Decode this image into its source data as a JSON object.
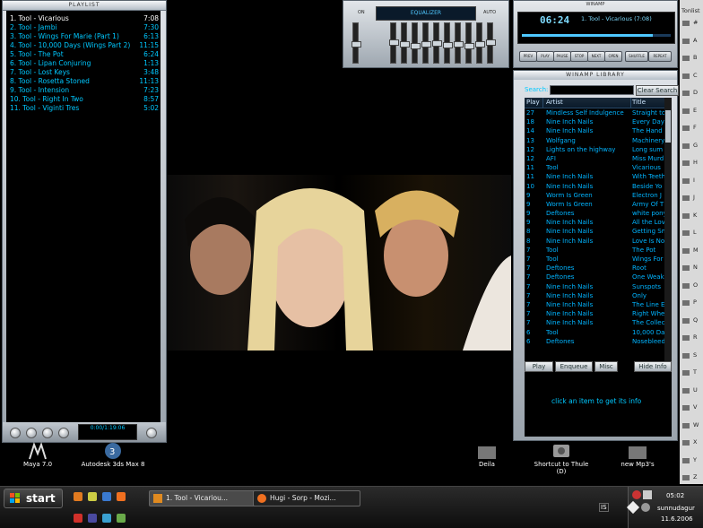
{
  "playlist": {
    "header": "PLAYLIST",
    "items": [
      {
        "title": "1. Tool - Vicarious",
        "duration": "7:08",
        "active": true
      },
      {
        "title": "2. Tool - Jambi",
        "duration": "7:30"
      },
      {
        "title": "3. Tool - Wings For Marie (Part 1)",
        "duration": "6:13"
      },
      {
        "title": "4. Tool - 10,000 Days (Wings Part 2)",
        "duration": "11:15"
      },
      {
        "title": "5. Tool - The Pot",
        "duration": "6:24"
      },
      {
        "title": "6. Tool - Lipan Conjuring",
        "duration": "1:13"
      },
      {
        "title": "7. Tool - Lost Keys",
        "duration": "3:48"
      },
      {
        "title": "8. Tool - Rosetta Stoned",
        "duration": "11:13"
      },
      {
        "title": "9. Tool - Intension",
        "duration": "7:23"
      },
      {
        "title": "10. Tool - Right In Two",
        "duration": "8:57"
      },
      {
        "title": "11. Tool - Viginti Tres",
        "duration": "5:02"
      }
    ],
    "time_display": "0:00/1:19:06"
  },
  "equalizer": {
    "title": "EQUALIZER",
    "on_label": "ON",
    "auto_label": "AUTO"
  },
  "player": {
    "title": "WINAMP",
    "time": "06:24",
    "song": "1. Tool - Vicarious (7:08)",
    "controls": [
      "PREV",
      "PLAY",
      "PAUSE",
      "STOP",
      "NEXT",
      "OPEN"
    ],
    "shuffle": "SHUFFLE",
    "repeat": "REPEAT"
  },
  "library": {
    "title": "WINAMP LIBRARY",
    "search_label": "Search:",
    "clear_search": "Clear Search",
    "columns": [
      "Play",
      "Artist",
      "Title"
    ],
    "rows": [
      {
        "play": "27",
        "artist": "Mindless Self Indulgence",
        "title": "Straight to"
      },
      {
        "play": "18",
        "artist": "Nine Inch Nails",
        "title": "Every Day"
      },
      {
        "play": "14",
        "artist": "Nine Inch Nails",
        "title": "The Hand"
      },
      {
        "play": "13",
        "artist": "Wolfgang",
        "title": "Machinery"
      },
      {
        "play": "12",
        "artist": "Lights on the highway",
        "title": "Long sum"
      },
      {
        "play": "12",
        "artist": "AFI",
        "title": "Miss Murd"
      },
      {
        "play": "11",
        "artist": "Tool",
        "title": "Vicarious"
      },
      {
        "play": "11",
        "artist": "Nine Inch Nails",
        "title": "With Teeth"
      },
      {
        "play": "10",
        "artist": "Nine Inch Nails",
        "title": "Beside Yo"
      },
      {
        "play": "9",
        "artist": "Worm Is Green",
        "title": "Electron J"
      },
      {
        "play": "9",
        "artist": "Worm Is Green",
        "title": "Army Of T"
      },
      {
        "play": "9",
        "artist": "Deftones",
        "title": "white pony"
      },
      {
        "play": "9",
        "artist": "Nine Inch Nails",
        "title": "All the Lov"
      },
      {
        "play": "8",
        "artist": "Nine Inch Nails",
        "title": "Getting Sm"
      },
      {
        "play": "8",
        "artist": "Nine Inch Nails",
        "title": "Love Is No"
      },
      {
        "play": "7",
        "artist": "Tool",
        "title": "The Pot"
      },
      {
        "play": "7",
        "artist": "Tool",
        "title": "Wings For"
      },
      {
        "play": "7",
        "artist": "Deftones",
        "title": "Root"
      },
      {
        "play": "7",
        "artist": "Deftones",
        "title": "One Weak"
      },
      {
        "play": "7",
        "artist": "Nine Inch Nails",
        "title": "Sunspots"
      },
      {
        "play": "7",
        "artist": "Nine Inch Nails",
        "title": "Only"
      },
      {
        "play": "7",
        "artist": "Nine Inch Nails",
        "title": "The Line E"
      },
      {
        "play": "7",
        "artist": "Nine Inch Nails",
        "title": "Right Whe"
      },
      {
        "play": "7",
        "artist": "Nine Inch Nails",
        "title": "The Collec"
      },
      {
        "play": "6",
        "artist": "Tool",
        "title": "10,000 Da"
      },
      {
        "play": "6",
        "artist": "Deftones",
        "title": "Nosebleed"
      }
    ],
    "buttons": {
      "play": "Play",
      "enqueue": "Enqueue",
      "misc": "Misc",
      "hide_info": "Hide Info"
    },
    "info_text": "click an item to get its info"
  },
  "sidebar": {
    "title": "Tonlist",
    "items": [
      "#",
      "A",
      "B",
      "C",
      "D",
      "E",
      "F",
      "G",
      "H",
      "I",
      "J",
      "K",
      "L",
      "M",
      "N",
      "O",
      "P",
      "Q",
      "R",
      "S",
      "T",
      "U",
      "V",
      "W",
      "X",
      "Y",
      "Z"
    ]
  },
  "desktop_icons": [
    {
      "label": "Maya 7.0",
      "icon": "maya-icon"
    },
    {
      "label": "Autodesk 3ds Max 8",
      "icon": "3dsmax-icon"
    },
    {
      "label": "Deila",
      "icon": "folder-icon"
    },
    {
      "label": "Shortcut to Thule (D)",
      "icon": "drive-shortcut-icon"
    },
    {
      "label": "new Mp3's",
      "icon": "folder-icon"
    }
  ],
  "taskbar": {
    "start_label": "start",
    "tasks": [
      {
        "label": "1. Tool - Vicariou...",
        "active": true
      },
      {
        "label": "Hugi - Sorp - Mozi...",
        "active": false
      }
    ],
    "language": "IS",
    "clock_time": "05:02",
    "clock_day": "sunnudagur",
    "clock_date": "11.6.2006"
  },
  "colors": {
    "accent": "#00c8ff",
    "desktop_bg": "#000000"
  }
}
